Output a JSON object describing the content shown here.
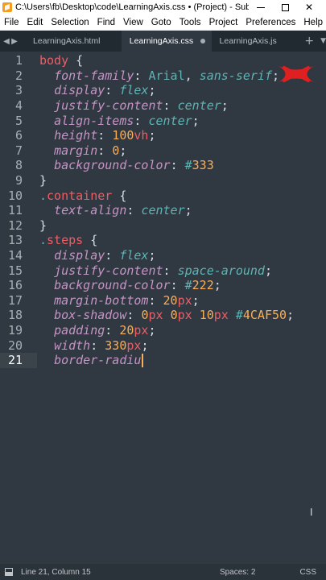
{
  "window": {
    "title": "C:\\Users\\fb\\Desktop\\code\\LearningAxis.css • (Project) - Subl...",
    "minimize": "—",
    "maximize": "☐",
    "close": "✕"
  },
  "menu": {
    "items": [
      "File",
      "Edit",
      "Selection",
      "Find",
      "View",
      "Goto",
      "Tools",
      "Project",
      "Preferences",
      "Help"
    ]
  },
  "tabs": {
    "items": [
      {
        "label": "LearningAxis.html"
      },
      {
        "label": "LearningAxis.css"
      },
      {
        "label": "LearningAxis.js"
      }
    ],
    "plus": "+"
  },
  "editor": {
    "current_line": 21
  },
  "status": {
    "position": "Line 21, Column 15",
    "spaces": "Spaces: 2",
    "syntax": "CSS"
  },
  "colors": {
    "background": "#303841",
    "selector": "#ec5f66",
    "property": "#c695c6",
    "value": "#5fb4b4",
    "number": "#f9ae58",
    "annotation_red": "#e02020"
  }
}
